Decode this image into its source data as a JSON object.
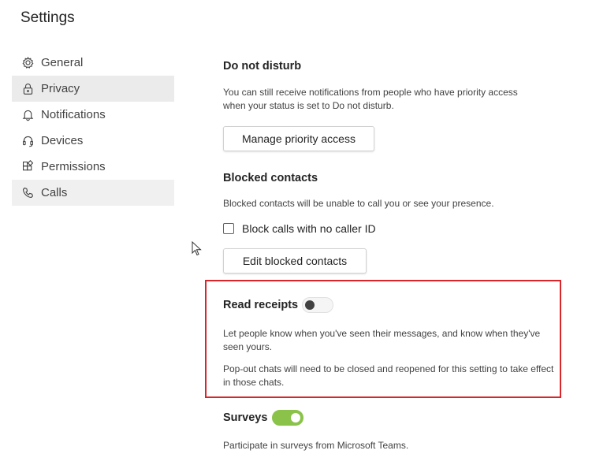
{
  "window": {
    "title": "Settings"
  },
  "sidebar": {
    "items": [
      {
        "label": "General",
        "icon": "gear-icon"
      },
      {
        "label": "Privacy",
        "icon": "lock-icon"
      },
      {
        "label": "Notifications",
        "icon": "bell-icon"
      },
      {
        "label": "Devices",
        "icon": "headset-icon"
      },
      {
        "label": "Permissions",
        "icon": "apps-icon"
      },
      {
        "label": "Calls",
        "icon": "phone-icon"
      }
    ],
    "selected": "Privacy"
  },
  "dnd": {
    "heading": "Do not disturb",
    "description": "You can still receive notifications from people who have priority access when your status is set to Do not disturb.",
    "button": "Manage priority access"
  },
  "blocked": {
    "heading": "Blocked contacts",
    "description": "Blocked contacts will be unable to call you or see your presence.",
    "checkbox_label": "Block calls with no caller ID",
    "checkbox_checked": false,
    "button": "Edit blocked contacts"
  },
  "read_receipts": {
    "heading": "Read receipts",
    "toggle_on": false,
    "description1": "Let people know when you've seen their messages, and know when they've seen yours.",
    "description2": "Pop-out chats will need to be closed and reopened for this setting to take effect in those chats."
  },
  "surveys": {
    "heading": "Surveys",
    "toggle_on": true,
    "description": "Participate in surveys from Microsoft Teams."
  },
  "colors": {
    "highlight": "#d9262b",
    "toggle_on": "#8bc34a",
    "nav_selected": "#ebebeb"
  }
}
